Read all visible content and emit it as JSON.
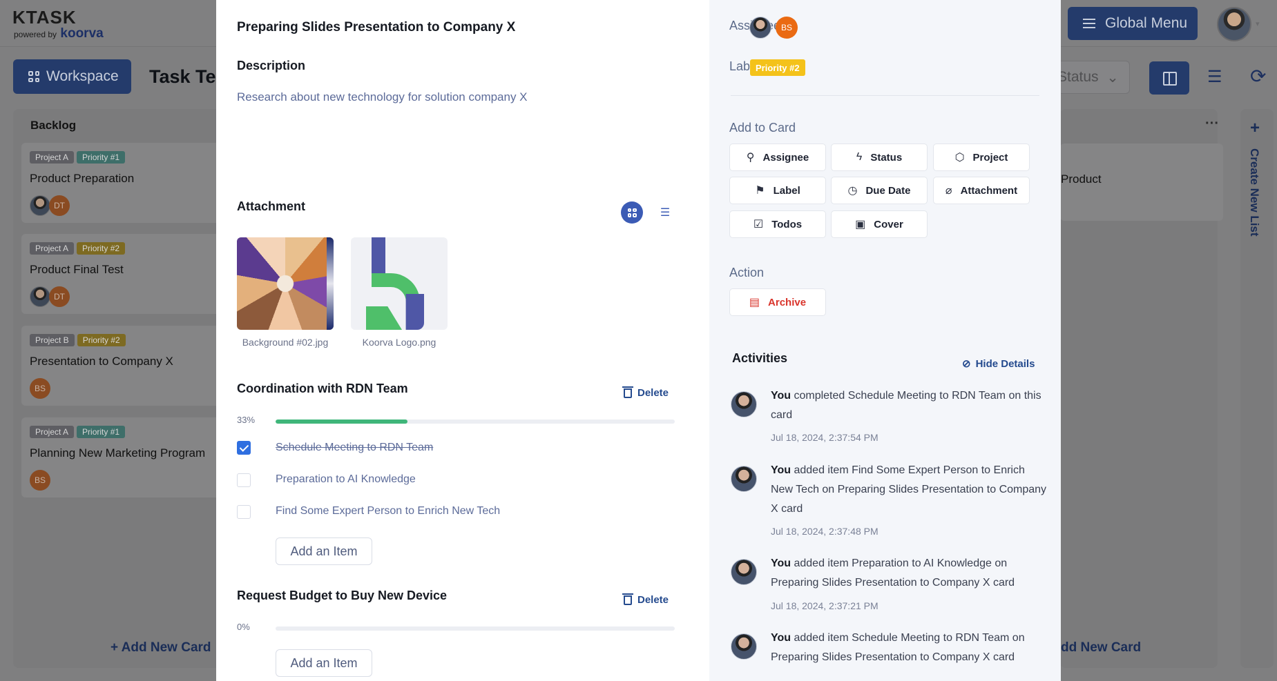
{
  "app": {
    "logo": "KTASK",
    "powered_by": "powered by",
    "brand": "koorva",
    "global_menu": "Global Menu",
    "workspace_button": "Workspace",
    "page_title": "Task Tea",
    "status_filter": "Status",
    "backlog": {
      "title": "Backlog",
      "cards": [
        {
          "project": "Project A",
          "priority": "Priority #1",
          "title": "Product Preparation",
          "avatars": [
            "photo",
            "DT"
          ]
        },
        {
          "project": "Project A",
          "priority": "Priority #2",
          "title": "Product Final Test",
          "avatars": [
            "photo",
            "DT"
          ]
        },
        {
          "project": "Project B",
          "priority": "Priority #2",
          "title": "Presentation to Company X",
          "avatars": [
            "BS"
          ]
        },
        {
          "project": "Project A",
          "priority": "Priority #1",
          "title": "Planning New Marketing Program",
          "avatars": [
            "BS"
          ]
        }
      ],
      "add_card": "+ Add New Card"
    },
    "right_column": {
      "card_title": "Product",
      "add_card": "dd New Card"
    },
    "create_new_list": "Create New List"
  },
  "modal": {
    "title": "Preparing Slides Presentation to Company X",
    "description_heading": "Description",
    "description": "Research about new technology for solution company X",
    "attachment_heading": "Attachment",
    "attachments": [
      {
        "name": "Background #02.jpg"
      },
      {
        "name": "Koorva Logo.png"
      }
    ],
    "checklists": [
      {
        "title": "Coordination with RDN Team",
        "delete_label": "Delete",
        "percent_label": "33%",
        "progress": 0.33,
        "items": [
          {
            "text": "Schedule Meeting to RDN Team",
            "done": true
          },
          {
            "text": "Preparation to AI Knowledge",
            "done": false
          },
          {
            "text": "Find Some Expert Person to Enrich New Tech",
            "done": false
          }
        ],
        "add_item_label": "Add an Item"
      },
      {
        "title": "Request Budget to Buy New Device",
        "delete_label": "Delete",
        "percent_label": "0%",
        "progress": 0,
        "items": [],
        "add_item_label": "Add an Item"
      }
    ],
    "sidebar": {
      "assignees_label": "Assignees",
      "assignees": [
        "photo",
        "BS"
      ],
      "labels_label": "Labels",
      "label_badge": "Priority #2",
      "add_to_card_label": "Add to Card",
      "add_to_card_buttons": [
        {
          "label": "Assignee",
          "icon": "add-user-icon"
        },
        {
          "label": "Status",
          "icon": "lightning-icon"
        },
        {
          "label": "Project",
          "icon": "box-icon"
        },
        {
          "label": "Label",
          "icon": "bookmark-icon"
        },
        {
          "label": "Due Date",
          "icon": "clock-icon"
        },
        {
          "label": "Attachment",
          "icon": "paperclip-icon"
        },
        {
          "label": "Todos",
          "icon": "checkbox-icon"
        },
        {
          "label": "Cover",
          "icon": "image-icon"
        }
      ],
      "action_label": "Action",
      "archive_label": "Archive",
      "activities_heading": "Activities",
      "hide_details": "Hide Details",
      "activities": [
        {
          "actor": "You",
          "text": " completed Schedule Meeting to RDN Team on this card",
          "time": "Jul 18, 2024, 2:37:54 PM"
        },
        {
          "actor": "You",
          "text": " added item Find Some Expert Person to Enrich New Tech on Preparing Slides Presentation to Company X card",
          "time": "Jul 18, 2024, 2:37:48 PM"
        },
        {
          "actor": "You",
          "text": " added item Preparation to AI Knowledge on Preparing Slides Presentation to Company X card",
          "time": "Jul 18, 2024, 2:37:21 PM"
        },
        {
          "actor": "You",
          "text": " added item Schedule Meeting to RDN Team on Preparing Slides Presentation to Company X card",
          "time": ""
        }
      ]
    }
  },
  "colors": {
    "accent": "#244a8e",
    "progress": "#3fb67a",
    "priority_badge": "#f4c21a",
    "archive": "#d9342b",
    "assignee_bs": "#ea6a12"
  }
}
